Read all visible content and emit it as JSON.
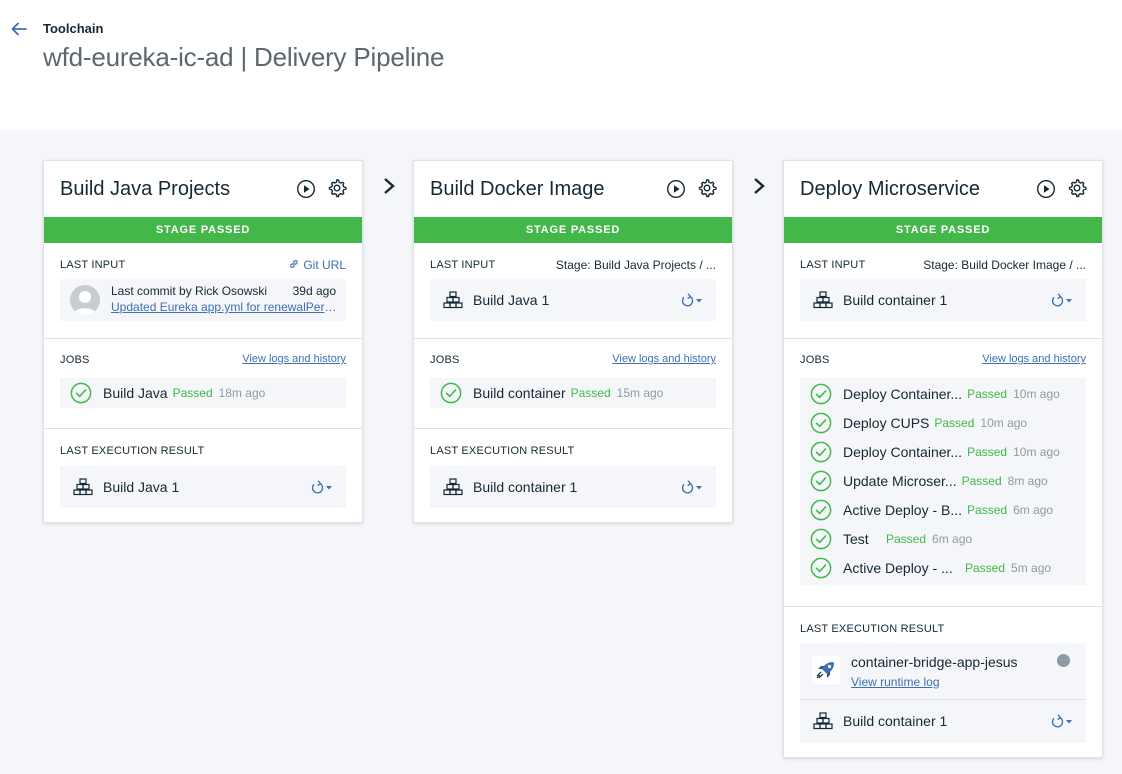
{
  "header": {
    "breadcrumb": "Toolchain",
    "title": "wfd-eureka-ic-ad | Delivery Pipeline"
  },
  "colors": {
    "passed": "#43b749",
    "link": "#3d70b2",
    "canvas": "#f4f6f9"
  },
  "common": {
    "stage_status": "STAGE PASSED",
    "last_input": "LAST INPUT",
    "jobs": "JOBS",
    "view_logs": "View logs and history",
    "last_result": "LAST EXECUTION RESULT",
    "passed": "Passed"
  },
  "stages": [
    {
      "title": "Build Java Projects",
      "input": {
        "link": "Git URL",
        "commit_by": "Last commit by Rick Osowski",
        "commit_age": "39d ago",
        "commit_msg": "Updated Eureka app.yml for renewalPercentThreshold"
      },
      "jobs": [
        {
          "name": "Build Java",
          "ago": "18m ago"
        }
      ],
      "result": "Build Java 1"
    },
    {
      "title": "Build Docker Image",
      "input": {
        "source": "Stage: Build Java Projects  /  ...",
        "item": "Build Java 1"
      },
      "jobs": [
        {
          "name": "Build container",
          "ago": "15m ago"
        }
      ],
      "result": "Build container 1"
    },
    {
      "title": "Deploy Microservice",
      "input": {
        "source": "Stage: Build Docker Image  /  ...",
        "item": "Build container 1"
      },
      "jobs": [
        {
          "name": "Deploy Container...",
          "ago": "10m ago"
        },
        {
          "name": "Deploy CUPS",
          "ago": "10m ago"
        },
        {
          "name": "Deploy Container...",
          "ago": "10m ago"
        },
        {
          "name": "Update Microser...",
          "ago": "8m ago"
        },
        {
          "name": "Active Deploy - B...",
          "ago": "6m ago"
        },
        {
          "name": "Test",
          "ago": "6m ago"
        },
        {
          "name": "Active Deploy - ...",
          "ago": "5m ago"
        }
      ],
      "result_app": {
        "name": "container-bridge-app-jesus",
        "log": "View runtime log"
      },
      "result": "Build container 1"
    }
  ]
}
